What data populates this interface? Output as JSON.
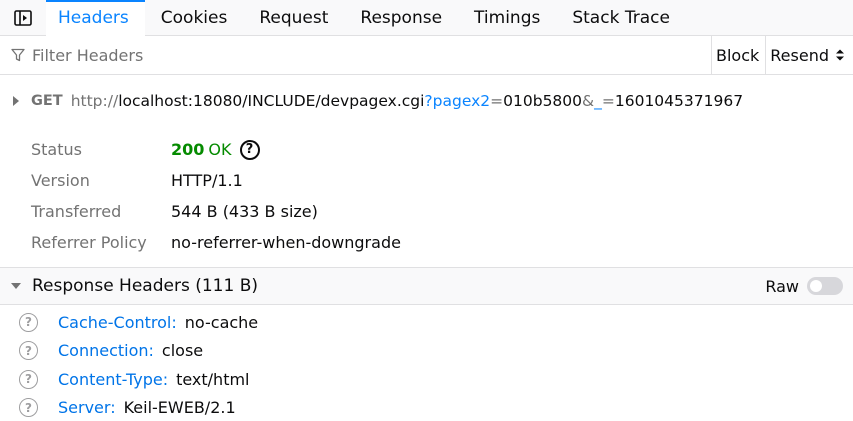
{
  "tabs": [
    {
      "label": "Headers",
      "active": true
    },
    {
      "label": "Cookies"
    },
    {
      "label": "Request"
    },
    {
      "label": "Response"
    },
    {
      "label": "Timings"
    },
    {
      "label": "Stack Trace"
    }
  ],
  "filter": {
    "placeholder": "Filter Headers",
    "block_label": "Block",
    "resend_label": "Resend"
  },
  "request": {
    "method": "GET",
    "url_scheme": "http://",
    "url_host_path": "localhost:18080/INCLUDE/devpagex.cgi",
    "q_mark": "?",
    "param1_key": "pagex2",
    "eq1": "=",
    "param1_value": "010b5800",
    "amp": "&",
    "param2_key": "_",
    "eq2": "=",
    "param2_value": "1601045371967"
  },
  "summary": {
    "status_label": "Status",
    "status_code": "200",
    "status_text": "OK",
    "version_label": "Version",
    "version_value": "HTTP/1.1",
    "transferred_label": "Transferred",
    "transferred_value": "544 B (433 B size)",
    "referrer_label": "Referrer Policy",
    "referrer_value": "no-referrer-when-downgrade"
  },
  "response_headers": {
    "title": "Response Headers (111 B)",
    "raw_label": "Raw",
    "raw_enabled": false,
    "items": [
      {
        "name": "Cache-Control:",
        "value": "no-cache"
      },
      {
        "name": "Connection:",
        "value": "close"
      },
      {
        "name": "Content-Type:",
        "value": "text/html"
      },
      {
        "name": "Server:",
        "value": "Keil-EWEB/2.1"
      }
    ]
  },
  "colors": {
    "accent": "#0a84ff",
    "status_ok": "#058b00",
    "header_name": "#0074e8"
  },
  "icons": {
    "panel_toggle": "sidebar-toggle-icon",
    "filter": "funnel-icon",
    "twisty": "triangle-right-icon",
    "help": "question-circle-icon"
  }
}
